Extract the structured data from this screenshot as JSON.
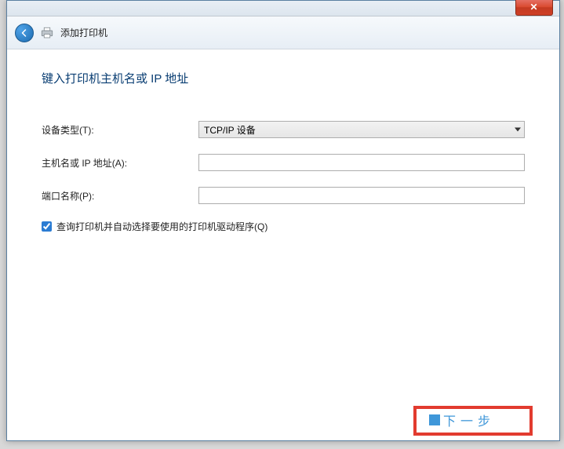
{
  "window": {
    "close_symbol": "✕"
  },
  "header": {
    "title": "添加打印机"
  },
  "page": {
    "heading": "键入打印机主机名或 IP 地址"
  },
  "form": {
    "device_type": {
      "label": "设备类型(T):",
      "selected": "TCP/IP 设备"
    },
    "hostname": {
      "label": "主机名或 IP 地址(A):",
      "value": ""
    },
    "port": {
      "label": "端口名称(P):",
      "value": ""
    },
    "query_checkbox": {
      "label": "查询打印机并自动选择要使用的打印机驱动程序(Q)",
      "checked": true
    }
  },
  "footer": {
    "next_label": "下一步"
  }
}
